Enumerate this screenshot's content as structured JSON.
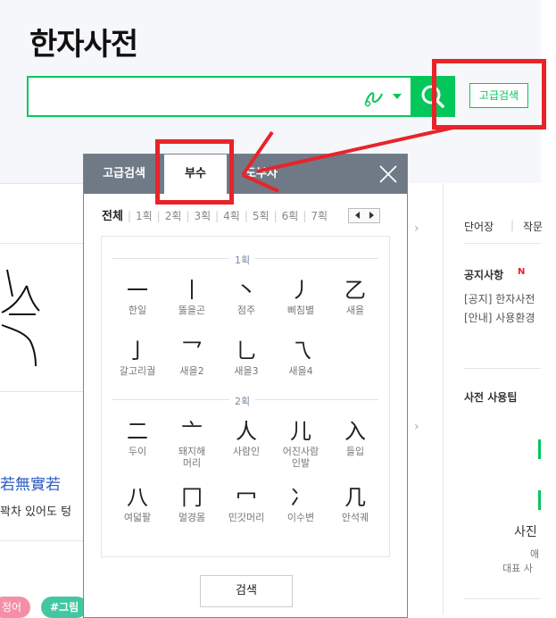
{
  "app": {
    "title": "한자사전",
    "advanced_search": "고급검색"
  },
  "search": {
    "value": "",
    "placeholder": ""
  },
  "popup": {
    "tabs": [
      "고급검색",
      "부수",
      "도부자"
    ],
    "active_tab": "부수",
    "strokes": [
      "전체",
      "1획",
      "2획",
      "3획",
      "4획",
      "5획",
      "6획",
      "7획"
    ],
    "groups": [
      {
        "label": "1획",
        "items": [
          {
            "char": "一",
            "name": "한일"
          },
          {
            "char": "丨",
            "name": "뚫을곤"
          },
          {
            "char": "丶",
            "name": "점주"
          },
          {
            "char": "丿",
            "name": "삐침별"
          },
          {
            "char": "乙",
            "name": "새을"
          },
          {
            "char": "亅",
            "name": "갈고리궐"
          },
          {
            "char": "乛",
            "name": "새을2"
          },
          {
            "char": "乚",
            "name": "새을3"
          },
          {
            "char": "乁",
            "name": "새을4"
          }
        ]
      },
      {
        "label": "2획",
        "items": [
          {
            "char": "二",
            "name": "두이"
          },
          {
            "char": "亠",
            "name": "돼지해머리"
          },
          {
            "char": "人",
            "name": "사람인"
          },
          {
            "char": "儿",
            "name": "어진사람인발"
          },
          {
            "char": "入",
            "name": "들입"
          },
          {
            "char": "八",
            "name": "여덟팔"
          },
          {
            "char": "冂",
            "name": "멀경몸"
          },
          {
            "char": "冖",
            "name": "민갓머리"
          },
          {
            "char": "冫",
            "name": "이수변"
          },
          {
            "char": "几",
            "name": "안석궤"
          }
        ]
      }
    ],
    "search_button": "검색"
  },
  "page": {
    "right_tabs": [
      "단어장",
      "작문"
    ],
    "notice_title": "공지사항",
    "notice_new": "N",
    "notices": [
      "[공지] 한자사전",
      "[안내] 사용환경"
    ],
    "tips_title": "사전 사용팁",
    "side_text": [
      "사진",
      "애",
      "대표 사"
    ],
    "left_phrase": "若無實若",
    "left_sub": "꽉차 있어도 텅",
    "tags": [
      "정어",
      "#그림"
    ]
  },
  "colors": {
    "accent": "#03c75a",
    "annotation": "#e8232a",
    "popup_header": "#6f7a86"
  }
}
